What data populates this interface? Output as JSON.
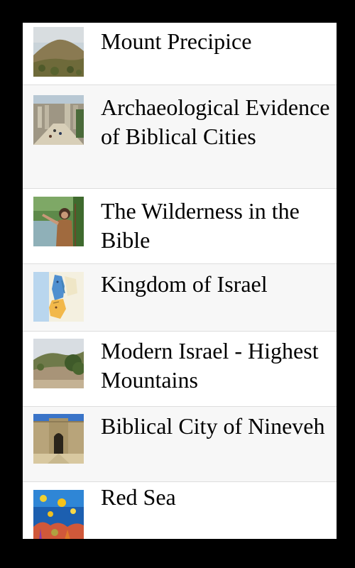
{
  "list": {
    "items": [
      {
        "label": "Mount Precipice",
        "thumbnail": "hill-landscape-photo"
      },
      {
        "label": "Archaeological Evidence of Biblical Cities",
        "thumbnail": "ancient-ruins-street-photo"
      },
      {
        "label": "The Wilderness in the Bible",
        "thumbnail": "man-by-river-photo"
      },
      {
        "label": "Kingdom of Israel",
        "thumbnail": "map-thumbnail"
      },
      {
        "label": "Modern Israel - Highest Mountains",
        "thumbnail": "mountain-landscape-photo"
      },
      {
        "label": "Biblical City of Nineveh",
        "thumbnail": "ancient-gate-photo"
      },
      {
        "label": "Red Sea",
        "thumbnail": "coral-reef-fish-photo"
      }
    ]
  },
  "colors": {
    "frame": "#000000",
    "row_light": "#ffffff",
    "row_alt": "#f7f7f7",
    "divider": "#dddddd",
    "text": "#000000"
  }
}
